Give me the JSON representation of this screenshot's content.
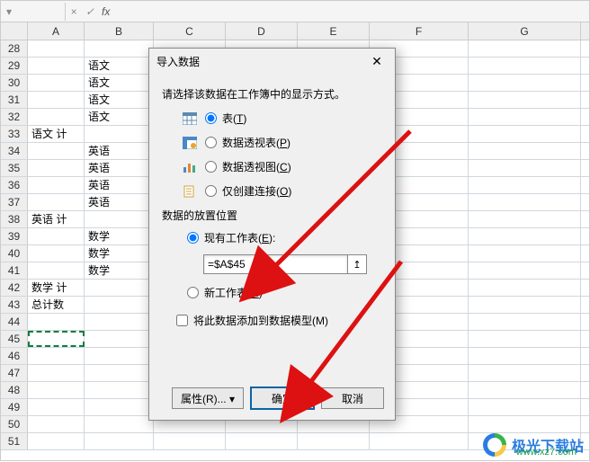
{
  "formula_bar": {
    "fx": "fx",
    "value": ""
  },
  "columns": [
    "A",
    "B",
    "C",
    "D",
    "E",
    "F",
    "G"
  ],
  "row_start": 28,
  "row_end": 51,
  "cells": {
    "29B": "语文",
    "30B": "语文",
    "31B": "语文",
    "32B": "语文",
    "33A": "语文  计",
    "34B": "英语",
    "35B": "英语",
    "36B": "英语",
    "37B": "英语",
    "38A": "英语  计",
    "39B": "数学",
    "40B": "数学",
    "41B": "数学",
    "42A": "数学  计",
    "43A": "总计数"
  },
  "selected": "A45",
  "dialog": {
    "title": "导入数据",
    "instructions": "请选择该数据在工作簿中的显示方式。",
    "opt_table": "表",
    "opt_table_key": "T",
    "opt_pivot_table": "数据透视表",
    "opt_pivot_table_key": "P",
    "opt_pivot_chart": "数据透视图",
    "opt_pivot_chart_key": "C",
    "opt_conn": "仅创建连接",
    "opt_conn_key": "O",
    "loc_header": "数据的放置位置",
    "opt_existing": "现有工作表",
    "opt_existing_key": "E",
    "loc_value": "=$A$45",
    "opt_new": "新工作表",
    "opt_new_key": "N",
    "chk_model": "将此数据添加到数据模型",
    "chk_model_key": "M",
    "btn_attr": "属性(R)...",
    "btn_ok": "确定",
    "btn_cancel": "取消"
  },
  "watermark": {
    "name": "极光下载站",
    "url": "www.xz7.com"
  }
}
